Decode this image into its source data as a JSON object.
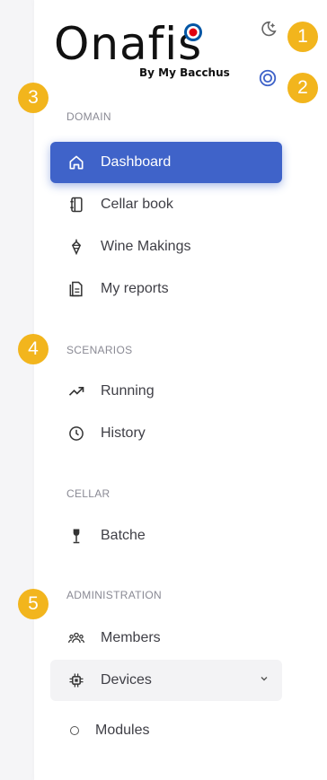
{
  "brand": {
    "name": "Onafis",
    "tagline": "By My Bacchus"
  },
  "header": {
    "theme_toggle_icon": "moon-icon",
    "target_icon": "target-icon"
  },
  "badges": [
    "1",
    "2",
    "3",
    "4",
    "5"
  ],
  "sections": {
    "domain": "DOMAIN",
    "scenarios": "SCENARIOS",
    "cellar": "CELLAR",
    "administration": "ADMINISTRATION"
  },
  "nav": {
    "dashboard": "Dashboard",
    "cellar_book": "Cellar book",
    "wine_makings": "Wine Makings",
    "my_reports": "My reports",
    "running": "Running",
    "history": "History",
    "batche": "Batche",
    "members": "Members",
    "devices": "Devices",
    "modules": "Modules"
  },
  "colors": {
    "accent": "#3f63c9",
    "badge": "#f2b51d",
    "section_text": "#8a8a94",
    "item_text": "#3f3f46"
  }
}
